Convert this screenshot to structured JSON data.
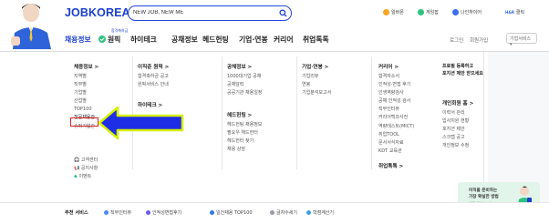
{
  "header": {
    "logo": "JOBKOREA",
    "search_value": "NEW JOB, NEW ME",
    "topics": [
      {
        "label": "일바몬",
        "color": "#f5a623"
      },
      {
        "label": "게임잡",
        "color": "#2ec27e"
      },
      {
        "label": "나인하이어",
        "color": "#3b6cf6"
      },
      {
        "label": "클릭",
        "color": "#2f63d9",
        "badge": "H&R"
      }
    ]
  },
  "nav": {
    "badge": "합격축하금",
    "items": [
      "채용정보",
      "원픽",
      "하이테크",
      "공채정보",
      "헤드헌팅",
      "기업·연봉",
      "커리어",
      "취업톡톡"
    ],
    "util": [
      "로그인",
      "회원가입"
    ],
    "service_select": "기업서비스"
  },
  "menu": {
    "col1": {
      "title": "채용정보 >",
      "items": [
        "지역별",
        "직무별",
        "기업별",
        "산업별",
        "TOP100",
        "전문채용관",
        "슈퍼기업관"
      ],
      "highlighted": "전문채용관",
      "extras": [
        "고객센터",
        "공지사항",
        "이벤트"
      ]
    },
    "col2": {
      "title": "이직준 원픽 >",
      "items": [
        "합격축하금 공고",
        "원픽서비스 안내"
      ],
      "title2": "하이테크 >"
    },
    "col3": {
      "title": "공채정보 >",
      "items": [
        "1000대기업 공채",
        "공채달력",
        "공공기관 채용일정"
      ],
      "title2": "헤드헌팅 >",
      "items2": [
        "헤드헌팅 채용정보",
        "필요우 헤드헌터",
        "헤드헌터 찾기",
        "채용 상담"
      ]
    },
    "col4": {
      "title": "기업·연봉 >",
      "items": [
        "기업리뷰",
        "연봉",
        "기업분석보고서"
      ]
    },
    "col5": {
      "title": "커리어 >",
      "items": [
        "합격자소서",
        "인적성·면접 후기",
        "인생역량검사",
        "공채 인적성 검사",
        "직무인터뷰",
        "커리어백과사전",
        "역량테스트(MICT)",
        "취업TOOL",
        "문서서식자료",
        "KDT 교육관"
      ],
      "title2": "취업톡톡 >"
    },
    "side": {
      "title1": "프로필 등록하고",
      "title1b": "포지션 제안 받으세요",
      "title2": "개인회원 홈 >",
      "items": [
        "이력서 관리",
        "입사지원 현황",
        "포지션 제안",
        "스크랩 공고",
        "개인정보 수정"
      ]
    },
    "banner": {
      "line1": "이직을 준비하는",
      "line2": "가장 확실한 방법",
      "line3": "원픽 알아보기"
    }
  },
  "recommend": {
    "label": "추천 서비스",
    "items": [
      {
        "label": "직무인터뷰",
        "color": "#4a8af4"
      },
      {
        "label": "인적성면접후기",
        "color": "#6a5af9"
      },
      {
        "label": "일간채용 TOP100",
        "color": "#2b7de9"
      },
      {
        "label": "글자수세기",
        "color": "#9a9aa8"
      },
      {
        "label": "학점계산기",
        "color": "#3aa0e8"
      }
    ]
  },
  "colors": {
    "brand": "#1a3fd1",
    "arrow_fill": "#1e2ee6",
    "arrow_outline": "#d6f000",
    "highlight": "#e02020"
  }
}
